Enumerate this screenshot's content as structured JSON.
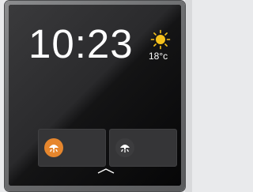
{
  "clock": {
    "time": "10:23"
  },
  "weather": {
    "icon": "sun-icon",
    "temperature": "18",
    "unit": "°c"
  },
  "cards": [
    {
      "icon": "light-fixture-icon",
      "accent": "#e6862d"
    },
    {
      "icon": "light-fixture-icon",
      "accent": "#3c3c3e"
    }
  ],
  "colors": {
    "screen": "#000000",
    "sun": "#f6c21c",
    "card": "#353537"
  }
}
